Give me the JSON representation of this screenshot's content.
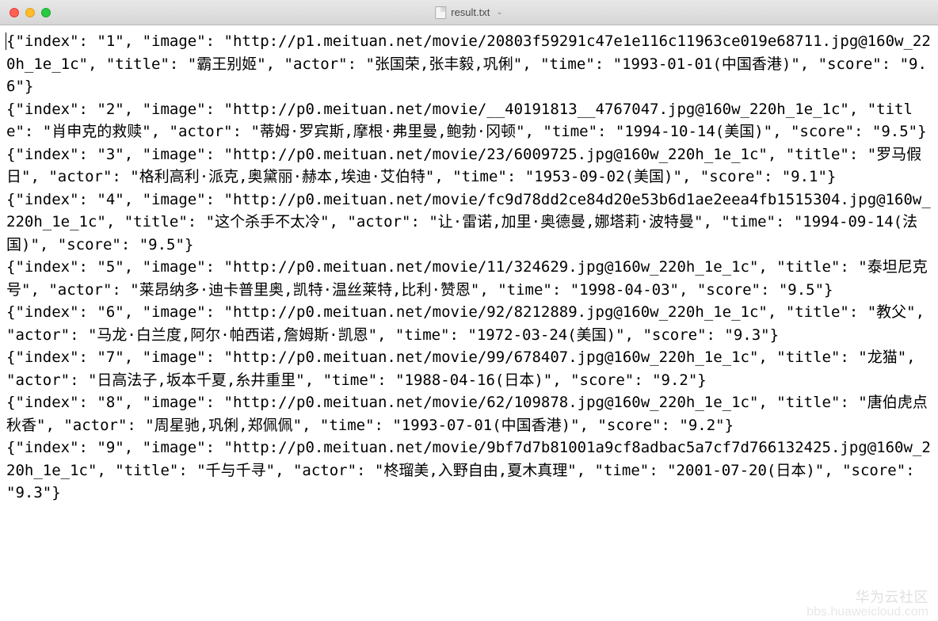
{
  "window": {
    "title": "result.txt",
    "dropdown_indicator": "⌄"
  },
  "traffic_lights": {
    "close": "close",
    "minimize": "minimize",
    "zoom": "zoom"
  },
  "file_lines": [
    "{\"index\": \"1\", \"image\": \"http://p1.meituan.net/movie/20803f59291c47e1e116c11963ce019e68711.jpg@160w_220h_1e_1c\", \"title\": \"霸王别姬\", \"actor\": \"张国荣,张丰毅,巩俐\", \"time\": \"1993-01-01(中国香港)\", \"score\": \"9.6\"}",
    "{\"index\": \"2\", \"image\": \"http://p0.meituan.net/movie/__40191813__4767047.jpg@160w_220h_1e_1c\", \"title\": \"肖申克的救赎\", \"actor\": \"蒂姆·罗宾斯,摩根·弗里曼,鲍勃·冈顿\", \"time\": \"1994-10-14(美国)\", \"score\": \"9.5\"}",
    "{\"index\": \"3\", \"image\": \"http://p0.meituan.net/movie/23/6009725.jpg@160w_220h_1e_1c\", \"title\": \"罗马假日\", \"actor\": \"格利高利·派克,奥黛丽·赫本,埃迪·艾伯特\", \"time\": \"1953-09-02(美国)\", \"score\": \"9.1\"}",
    "{\"index\": \"4\", \"image\": \"http://p0.meituan.net/movie/fc9d78dd2ce84d20e53b6d1ae2eea4fb1515304.jpg@160w_220h_1e_1c\", \"title\": \"这个杀手不太冷\", \"actor\": \"让·雷诺,加里·奥德曼,娜塔莉·波特曼\", \"time\": \"1994-09-14(法国)\", \"score\": \"9.5\"}",
    "{\"index\": \"5\", \"image\": \"http://p0.meituan.net/movie/11/324629.jpg@160w_220h_1e_1c\", \"title\": \"泰坦尼克号\", \"actor\": \"莱昂纳多·迪卡普里奥,凯特·温丝莱特,比利·赞恩\", \"time\": \"1998-04-03\", \"score\": \"9.5\"}",
    "{\"index\": \"6\", \"image\": \"http://p0.meituan.net/movie/92/8212889.jpg@160w_220h_1e_1c\", \"title\": \"教父\", \"actor\": \"马龙·白兰度,阿尔·帕西诺,詹姆斯·凯恩\", \"time\": \"1972-03-24(美国)\", \"score\": \"9.3\"}",
    "{\"index\": \"7\", \"image\": \"http://p0.meituan.net/movie/99/678407.jpg@160w_220h_1e_1c\", \"title\": \"龙猫\", \"actor\": \"日高法子,坂本千夏,糸井重里\", \"time\": \"1988-04-16(日本)\", \"score\": \"9.2\"}",
    "{\"index\": \"8\", \"image\": \"http://p0.meituan.net/movie/62/109878.jpg@160w_220h_1e_1c\", \"title\": \"唐伯虎点秋香\", \"actor\": \"周星驰,巩俐,郑佩佩\", \"time\": \"1993-07-01(中国香港)\", \"score\": \"9.2\"}",
    "{\"index\": \"9\", \"image\": \"http://p0.meituan.net/movie/9bf7d7b81001a9cf8adbac5a7cf7d766132425.jpg@160w_220h_1e_1c\", \"title\": \"千与千寻\", \"actor\": \"柊瑠美,入野自由,夏木真理\", \"time\": \"2001-07-20(日本)\", \"score\": \"9.3\"}"
  ],
  "watermark": {
    "line1": "华为云社区",
    "line2": "bbs.huaweicloud.com"
  }
}
